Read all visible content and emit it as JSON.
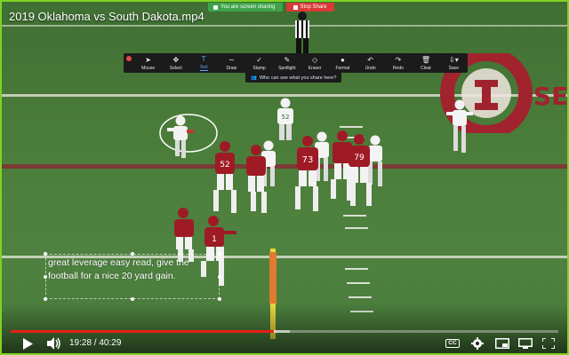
{
  "window": {
    "video_title": "2019 Oklahoma vs South Dakota.mp4",
    "frame_color": "#7ed321"
  },
  "screen_share": {
    "status_text": "You are screen sharing",
    "stop_label": "Stop Share",
    "status_color": "#3ea44a",
    "stop_color": "#d93a36"
  },
  "annotation_toolbar": {
    "tools": [
      {
        "label": "Mouse",
        "icon": "cursor-icon"
      },
      {
        "label": "Select",
        "icon": "move-icon"
      },
      {
        "label": "Text",
        "icon": "text-icon",
        "active": true
      },
      {
        "label": "Draw",
        "icon": "squiggle-icon"
      },
      {
        "label": "Stamp",
        "icon": "checkmark-icon"
      },
      {
        "label": "Spotlight",
        "icon": "spotlight-icon"
      },
      {
        "label": "Eraser",
        "icon": "eraser-icon"
      },
      {
        "label": "Format",
        "icon": "format-icon"
      },
      {
        "label": "Undo",
        "icon": "undo-icon"
      },
      {
        "label": "Redo",
        "icon": "redo-icon"
      },
      {
        "label": "Clear",
        "icon": "trash-icon"
      },
      {
        "label": "Save",
        "icon": "save-icon"
      }
    ],
    "active_color": "#5ba8ff",
    "who_can_see": "Who can see what you share here?"
  },
  "annotation": {
    "text": "great leverage easy read, give the football for a nice 20 yard gain."
  },
  "player": {
    "current_time": "19:28",
    "duration": "40:29",
    "time_display": "19:28 / 40:29",
    "progress_fraction": 0.481,
    "buffered_fraction": 0.51,
    "progress_color": "#e62117",
    "buttons": [
      "play-icon",
      "volume-icon",
      "captions-icon",
      "settings-icon",
      "miniplayer-icon",
      "cast-icon",
      "fullscreen-icon"
    ],
    "cc_label": "CC"
  },
  "scene": {
    "logo_text": "SEC",
    "team_color": "#9e1b26"
  }
}
